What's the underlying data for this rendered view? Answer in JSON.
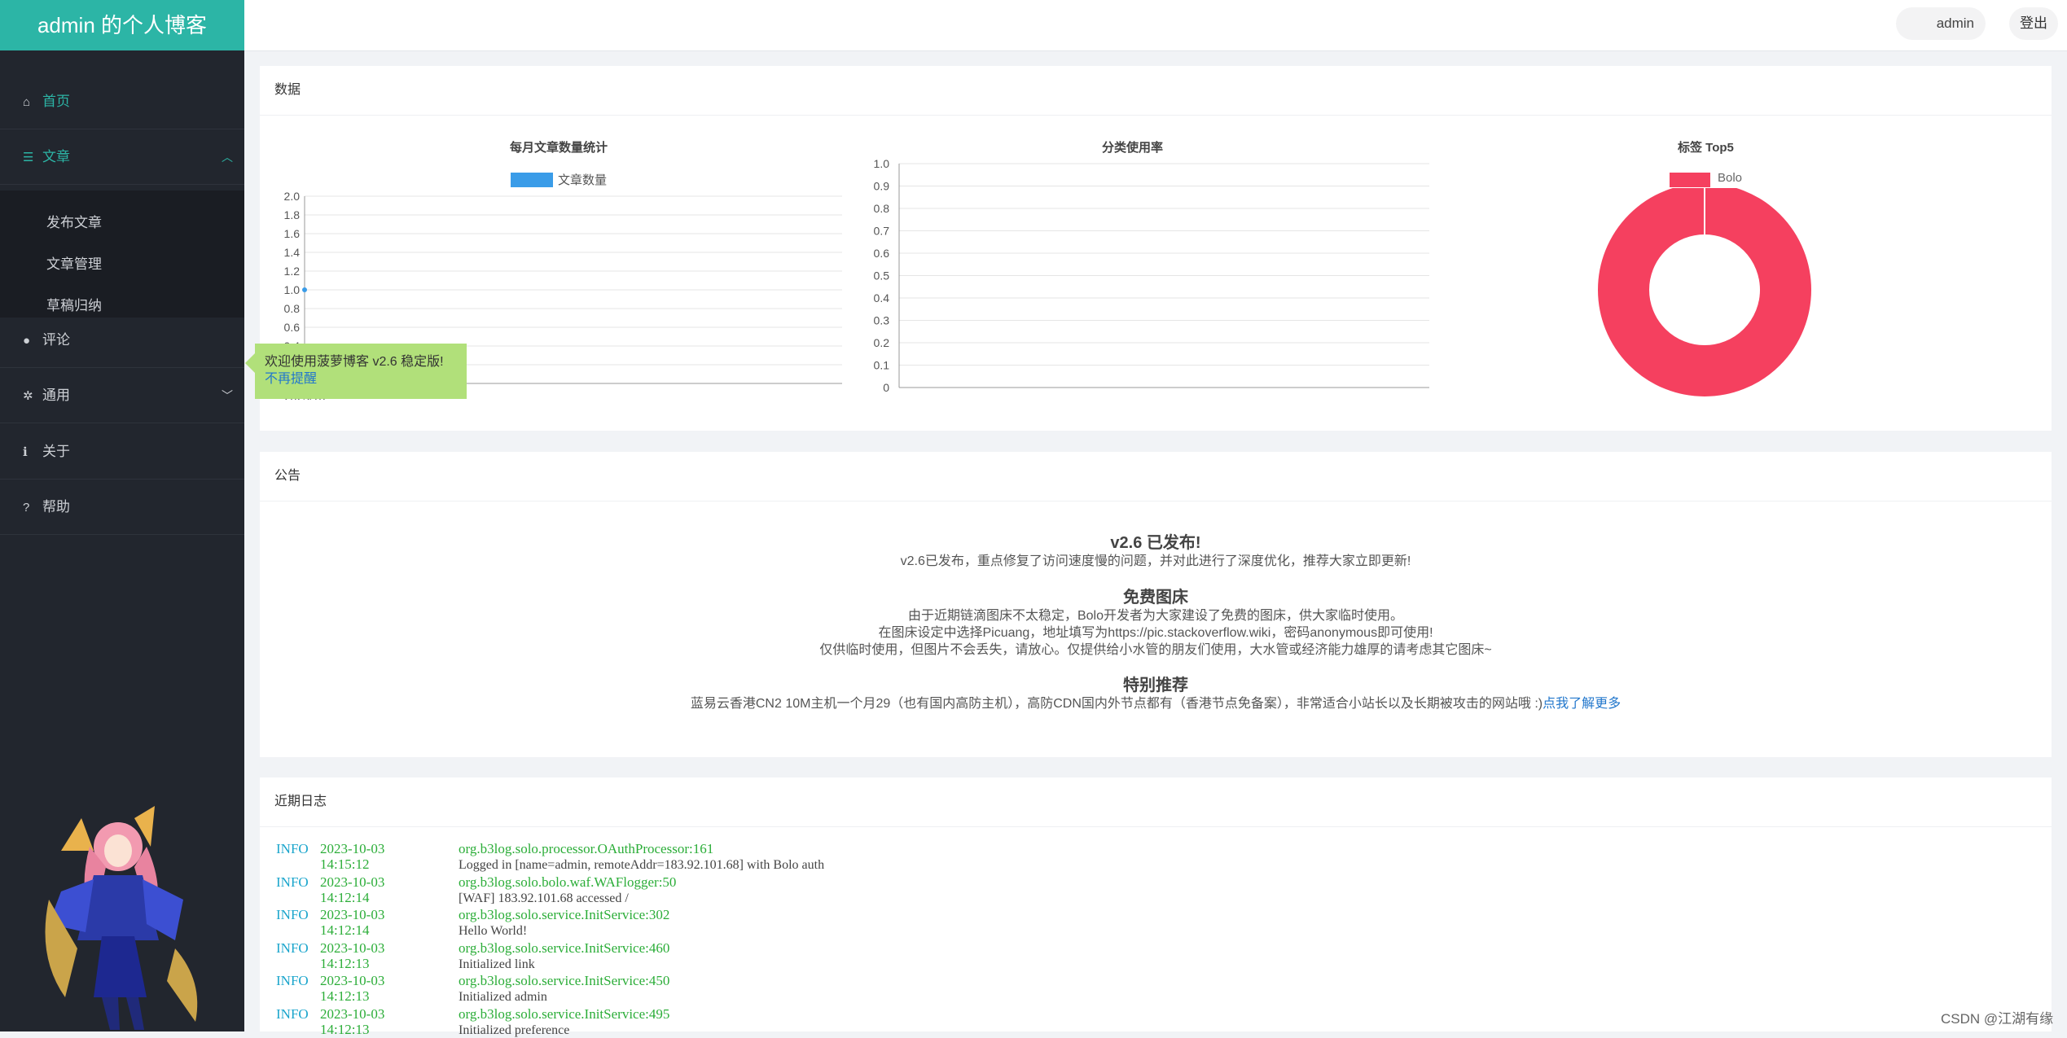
{
  "app": {
    "title": "admin 的个人博客"
  },
  "header": {
    "user": "admin",
    "logout": "登出"
  },
  "sidebar": {
    "items": [
      {
        "icon": "home-icon",
        "glyph": "⌂",
        "label": "首页"
      },
      {
        "icon": "list-icon",
        "glyph": "☰",
        "label": "文章"
      },
      {
        "icon": "comment-icon",
        "glyph": "●",
        "label": "评论"
      },
      {
        "icon": "gear-icon",
        "glyph": "✲",
        "label": "通用"
      },
      {
        "icon": "info-icon",
        "glyph": "ℹ",
        "label": "关于"
      },
      {
        "icon": "help-icon",
        "glyph": "?",
        "label": "帮助"
      }
    ],
    "sub_items": [
      "发布文章",
      "文章管理",
      "草稿归纳"
    ]
  },
  "data_panel": {
    "title": "数据"
  },
  "chart_data": [
    {
      "type": "line",
      "title": "每月文章数量统计",
      "legend": [
        "文章数量"
      ],
      "x": [
        "2023/10"
      ],
      "series": [
        {
          "name": "文章数量",
          "values": [
            1
          ]
        }
      ],
      "yticks": [
        "0",
        "0.2",
        "0.4",
        "0.6",
        "0.8",
        "1.0",
        "1.2",
        "1.4",
        "1.6",
        "1.8",
        "2.0"
      ],
      "ylim": [
        0,
        2
      ],
      "color": "#3a9ce8"
    },
    {
      "type": "bar",
      "title": "分类使用率",
      "categories": [],
      "series": [],
      "yticks": [
        "0",
        "0.1",
        "0.2",
        "0.3",
        "0.4",
        "0.5",
        "0.6",
        "0.7",
        "0.8",
        "0.9",
        "1.0"
      ],
      "ylim": [
        0,
        1
      ]
    },
    {
      "type": "pie",
      "title": "标签 Top5",
      "legend": [
        "Bolo"
      ],
      "slices": [
        {
          "label": "Bolo",
          "value": 1
        }
      ],
      "color": "#f5405f"
    }
  ],
  "toast": {
    "text": "欢迎使用菠萝博客 v2.6 稳定版!",
    "link": "不再提醒"
  },
  "announcement": {
    "title": "公告",
    "sections": [
      {
        "heading": "v2.6 已发布!",
        "lines": [
          "v2.6已发布，重点修复了访问速度慢的问题，并对此进行了深度优化，推荐大家立即更新!"
        ]
      },
      {
        "heading": "免费图床",
        "lines": [
          "由于近期链滴图床不太稳定，Bolo开发者为大家建设了免费的图床，供大家临时使用。",
          "在图床设定中选择Picuang，地址填写为https://pic.stackoverflow.wiki，密码anonymous即可使用!",
          "仅供临时使用，但图片不会丢失，请放心。仅提供给小水管的朋友们使用，大水管或经济能力雄厚的请考虑其它图床~"
        ]
      },
      {
        "heading": "特别推荐",
        "lines": [
          "蓝易云香港CN2 10M主机一个月29（也有国内高防主机），高防CDN国内外节点都有（香港节点免备案），非常适合小站长以及长期被攻击的网站哦 :)"
        ],
        "link": "点我了解更多"
      }
    ]
  },
  "logs": {
    "title": "近期日志",
    "rows": [
      {
        "level": "INFO",
        "date": "2023-10-03",
        "time": "14:15:12",
        "class": "org.b3log.solo.processor.OAuthProcessor:161",
        "msg": "Logged in [name=admin, remoteAddr=183.92.101.68] with Bolo auth"
      },
      {
        "level": "INFO",
        "date": "2023-10-03",
        "time": "14:12:14",
        "class": "org.b3log.solo.bolo.waf.WAFlogger:50",
        "msg": "[WAF] 183.92.101.68 accessed /"
      },
      {
        "level": "INFO",
        "date": "2023-10-03",
        "time": "14:12:14",
        "class": "org.b3log.solo.service.InitService:302",
        "msg": "Hello World!"
      },
      {
        "level": "INFO",
        "date": "2023-10-03",
        "time": "14:12:13",
        "class": "org.b3log.solo.service.InitService:460",
        "msg": "Initialized link"
      },
      {
        "level": "INFO",
        "date": "2023-10-03",
        "time": "14:12:13",
        "class": "org.b3log.solo.service.InitService:450",
        "msg": "Initialized admin"
      },
      {
        "level": "INFO",
        "date": "2023-10-03",
        "time": "14:12:13",
        "class": "org.b3log.solo.service.InitService:495",
        "msg": "Initialized preference"
      }
    ]
  },
  "watermark": "CSDN @江湖有缘"
}
